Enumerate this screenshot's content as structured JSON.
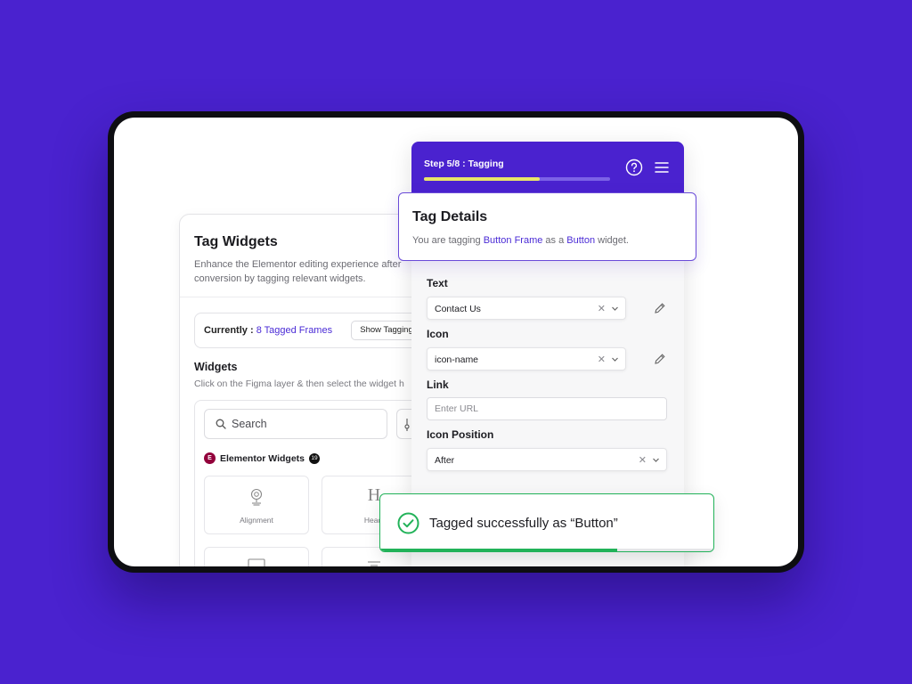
{
  "left_panel": {
    "title": "Tag Widgets",
    "description": "Enhance the Elementor editing experience after conversion by tagging relevant widgets.",
    "currently_label": "Currently : ",
    "tagged_count": "8 Tagged Frames",
    "show_tagging_label": "Show Tagging",
    "widgets_title": "Widgets",
    "widgets_description": "Click on the Figma layer & then select the widget h",
    "search_placeholder": "Search",
    "elementor_widgets_label": "Elementor Widgets",
    "elementor_badge": "19",
    "widget_cards": [
      {
        "label": "Alignment",
        "icon": "alignment-icon"
      },
      {
        "label": "Headi",
        "icon": "heading-icon"
      }
    ]
  },
  "right_panel": {
    "step_label": "Step 5/8 : Tagging",
    "progress_percent": 62,
    "fields": {
      "text_label": "Text",
      "text_value": "Contact Us",
      "icon_label": "Icon",
      "icon_value": "icon-name",
      "link_label": "Link",
      "link_placeholder": "Enter URL",
      "icon_position_label": "Icon Position",
      "icon_position_value": "After"
    }
  },
  "tag_details": {
    "title": "Tag Details",
    "desc_prefix": "You are tagging ",
    "frame_name": "Button Frame",
    "desc_middle": " as a ",
    "widget_name": "Button",
    "desc_suffix": " widget."
  },
  "toast": {
    "message": "Tagged successfully as “Button”",
    "progress_percent": 71
  },
  "colors": {
    "background": "#4a22cf",
    "accent": "#4a2bd6",
    "progress": "#e8e66a",
    "success": "#22b259"
  }
}
